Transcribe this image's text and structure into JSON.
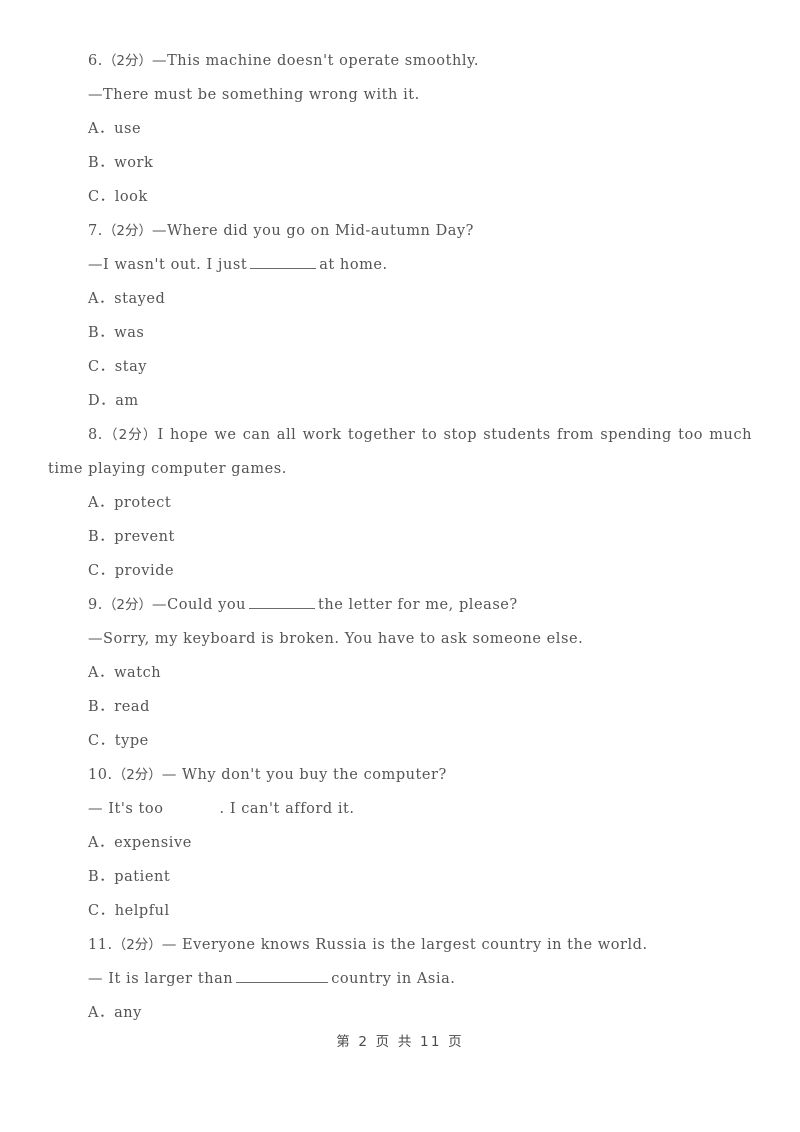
{
  "page": {
    "background_color": "#ffffff",
    "text_color": "#545454",
    "footer": "第 2 页 共 11 页"
  },
  "questions": [
    {
      "number": "6.",
      "score": "（2分）",
      "stem": "—This machine doesn't operate smoothly.",
      "reply": "—There must be something wrong with it.",
      "options": [
        {
          "letter": "A．",
          "text": "use"
        },
        {
          "letter": "B．",
          "text": "work"
        },
        {
          "letter": "C．",
          "text": "look"
        }
      ]
    },
    {
      "number": "7.",
      "score": "（2分）",
      "stem": "—Where did you go on Mid-autumn Day?",
      "reply_before": "—I wasn't out. I just",
      "reply_after": "at home.",
      "blank": "medium",
      "options": [
        {
          "letter": "A．",
          "text": "stayed"
        },
        {
          "letter": "B．",
          "text": "was"
        },
        {
          "letter": "C．",
          "text": "stay"
        },
        {
          "letter": "D．",
          "text": "am"
        }
      ]
    },
    {
      "number": "8.",
      "score": "（2分）",
      "stem": "I hope we can all work together to stop students from spending too much time playing computer games.",
      "options": [
        {
          "letter": "A．",
          "text": "protect"
        },
        {
          "letter": "B．",
          "text": "prevent"
        },
        {
          "letter": "C．",
          "text": "provide"
        }
      ]
    },
    {
      "number": "9.",
      "score": "（2分）",
      "stem_before": "—Could you",
      "stem_after": "the letter for me, please?",
      "blank": "medium",
      "reply": "—Sorry, my keyboard is broken. You have to ask someone else.",
      "options": [
        {
          "letter": "A．",
          "text": "watch"
        },
        {
          "letter": "B．",
          "text": "read"
        },
        {
          "letter": "C．",
          "text": "type"
        }
      ]
    },
    {
      "number": "10.",
      "score": "（2分）",
      "stem": "— Why don't you buy the computer?",
      "reply_before": "— It's too",
      "reply_after": ". I can't afford it.",
      "blank": "gap",
      "options": [
        {
          "letter": "A．",
          "text": "expensive"
        },
        {
          "letter": "B．",
          "text": "patient"
        },
        {
          "letter": "C．",
          "text": "helpful"
        }
      ]
    },
    {
      "number": "11.",
      "score": "（2分）",
      "stem": "— Everyone knows Russia is the largest country in the world.",
      "reply_before": "— It is larger than",
      "reply_after": "country in Asia.",
      "blank": "long",
      "options": [
        {
          "letter": "A．",
          "text": "any"
        }
      ]
    }
  ]
}
